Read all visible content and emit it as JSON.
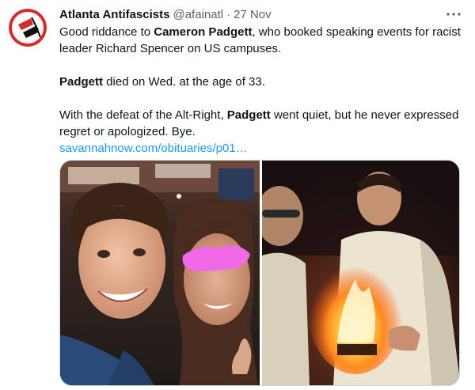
{
  "tweet": {
    "display_name": "Atlanta Antifascists",
    "handle": "@afainatl",
    "separator": "·",
    "timestamp": "27 Nov",
    "more_label": "···",
    "lines": {
      "p1_a": "Good riddance to ",
      "p1_bold": "Cameron Padgett",
      "p1_b": ", who booked speaking events for racist leader Richard Spencer on US campuses.",
      "p2_bold": "Padgett",
      "p2_b": " died on Wed. at the age of 33.",
      "p3_a": "With the defeat of the Alt-Right, ",
      "p3_bold": "Padgett",
      "p3_b": " went quiet, but he never expressed regret or apologized. Bye.",
      "link": "savannahnow.com/obituaries/p01…"
    }
  },
  "colors": {
    "text": "#0f1419",
    "secondary": "#536471",
    "link": "#1d9bf0",
    "avatar_red": "#d42b2b",
    "blur_pink": "#f06ae8"
  },
  "icons": {
    "avatar": "antifa-flags-logo",
    "more": "more-horizontal-icon"
  }
}
